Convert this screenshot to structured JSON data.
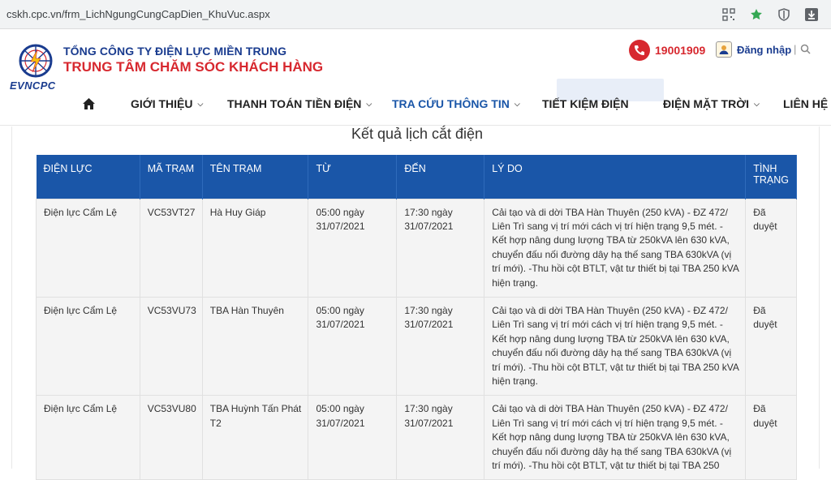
{
  "browser": {
    "url": "cskh.cpc.vn/frm_LichNgungCungCapDien_KhuVuc.aspx"
  },
  "header": {
    "org_line1": "TỔNG CÔNG TY ĐIỆN LỰC MIỀN TRUNG",
    "org_line2": "TRUNG TÂM CHĂM SÓC KHÁCH HÀNG",
    "brand": "EVNCPC",
    "hotline": "19001909",
    "login_label": "Đăng nhập",
    "separator": "|"
  },
  "nav": {
    "items": [
      {
        "label": "GIỚI THIỆU",
        "caret": true
      },
      {
        "label": "THANH TOÁN TIỀN ĐIỆN",
        "caret": true
      },
      {
        "label": "TRA CỨU THÔNG TIN",
        "caret": true,
        "active": true
      },
      {
        "label": "TIẾT KIỆM ĐIỆN",
        "caret": false
      },
      {
        "label": "ĐIỆN MẶT TRỜI",
        "caret": true
      },
      {
        "label": "LIÊN HỆ",
        "caret": false
      }
    ]
  },
  "main": {
    "title": "Kết quả lịch cắt điện",
    "columns": [
      "ĐIỆN LỰC",
      "MÃ TRẠM",
      "TÊN TRẠM",
      "TỪ",
      "ĐẾN",
      "LÝ DO",
      "TÌNH TRẠNG"
    ],
    "rows": [
      {
        "dienluc": "Điện lực Cẩm Lệ",
        "matram": "VC53VT27",
        "tentram": "Hà Huy Giáp",
        "tu": "05:00 ngày 31/07/2021",
        "den": "17:30 ngày 31/07/2021",
        "lydo": "Cải tạo và di dời TBA Hàn Thuyên (250 kVA) - ĐZ 472/ Liên Trì sang vị trí mới cách vị trí hiện trạng 9,5 mét. - Kết hợp nâng dung lượng TBA từ 250kVA lên 630 kVA, chuyển đấu nối đường dây hạ thế sang TBA 630kVA (vị trí mới). -Thu hồi cột BTLT, vật tư thiết bị tại TBA 250 kVA hiện trạng.",
        "tinhtrang": "Đã duyệt"
      },
      {
        "dienluc": "Điện lực Cẩm Lệ",
        "matram": "VC53VU73",
        "tentram": "TBA Hàn Thuyên",
        "tu": "05:00 ngày 31/07/2021",
        "den": "17:30 ngày 31/07/2021",
        "lydo": "Cải tạo và di dời TBA Hàn Thuyên (250 kVA) - ĐZ 472/ Liên Trì sang vị trí mới cách vị trí hiện trạng 9,5 mét. - Kết hợp nâng dung lượng TBA từ 250kVA lên 630 kVA, chuyển đấu nối đường dây hạ thế sang TBA 630kVA (vị trí mới). -Thu hồi cột BTLT, vật tư thiết bị tại TBA 250 kVA hiện trạng.",
        "tinhtrang": "Đã duyệt"
      },
      {
        "dienluc": "Điện lực Cẩm Lệ",
        "matram": "VC53VU80",
        "tentram": "TBA Huỳnh Tấn Phát T2",
        "tu": "05:00 ngày 31/07/2021",
        "den": "17:30 ngày 31/07/2021",
        "lydo": "Cải tạo và di dời TBA Hàn Thuyên (250 kVA) - ĐZ 472/ Liên Trì sang vị trí mới cách vị trí hiện trạng 9,5 mét. - Kết hợp nâng dung lượng TBA từ 250kVA lên 630 kVA, chuyển đấu nối đường dây hạ thế sang TBA 630kVA (vị trí mới). -Thu hồi cột BTLT, vật tư thiết bị tại TBA 250",
        "tinhtrang": "Đã duyệt"
      }
    ]
  },
  "colors": {
    "brand_blue": "#1a3c8f",
    "brand_red": "#d7282f",
    "table_header": "#1a56a8"
  },
  "icons": [
    "qr-code-icon",
    "star-icon",
    "shield-icon",
    "download-icon",
    "phone-icon",
    "user-icon",
    "search-icon",
    "home-icon"
  ]
}
